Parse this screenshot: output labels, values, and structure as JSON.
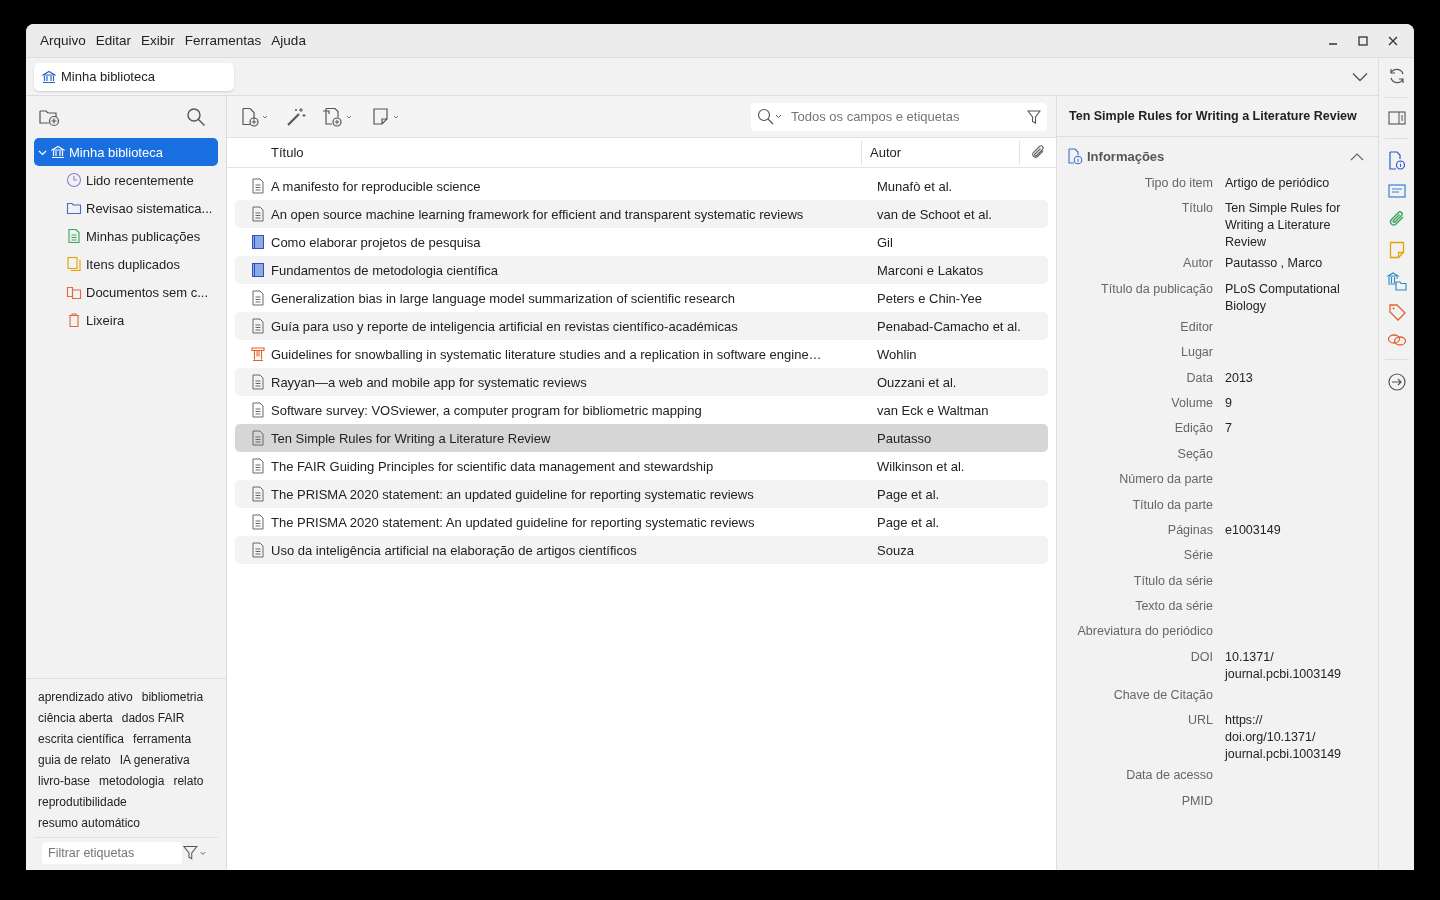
{
  "menu": [
    "Arquivo",
    "Editar",
    "Exibir",
    "Ferramentas",
    "Ajuda"
  ],
  "tab": {
    "label": "Minha biblioteca"
  },
  "collections": [
    {
      "label": "Minha biblioteca",
      "kind": "library",
      "selected": true,
      "expanded": true,
      "children": [
        {
          "label": "Lido recentemente",
          "kind": "recent",
          "selected": false
        },
        {
          "label": "Revisao sistematica...",
          "kind": "folder",
          "selected": false
        },
        {
          "label": "Minhas publicações",
          "kind": "publications",
          "selected": false
        },
        {
          "label": "Itens duplicados",
          "kind": "duplicates",
          "selected": false
        },
        {
          "label": "Documentos sem c...",
          "kind": "unfiled",
          "selected": false
        },
        {
          "label": "Lixeira",
          "kind": "trash",
          "selected": false
        }
      ]
    }
  ],
  "tags": [
    "aprendizado ativo",
    "bibliometria",
    "ciência aberta",
    "dados FAIR",
    "escrita científica",
    "ferramenta",
    "guia de relato",
    "IA generativa",
    "livro-base",
    "metodologia",
    "relato",
    "reprodutibilidade",
    "resumo automático"
  ],
  "tag_filter": {
    "placeholder": "Filtrar etiquetas"
  },
  "search": {
    "placeholder": "Todos os campos e etiquetas"
  },
  "table": {
    "columns": [
      "Título",
      "Autor"
    ],
    "rows": [
      {
        "kind": "article",
        "title": "A manifesto for reproducible science",
        "author": "Munafò et al.",
        "selected": false
      },
      {
        "kind": "article",
        "title": "An open source machine learning framework for efficient and transparent systematic reviews",
        "author": "van de Schoot et al.",
        "selected": false
      },
      {
        "kind": "book",
        "title": "Como elaborar projetos de pesquisa",
        "author": "Gil",
        "selected": false
      },
      {
        "kind": "book",
        "title": "Fundamentos de metodologia científica",
        "author": "Marconi e Lakatos",
        "selected": false
      },
      {
        "kind": "article",
        "title": "Generalization bias in large language model summarization of scientific research",
        "author": "Peters e Chin-Yee",
        "selected": false
      },
      {
        "kind": "article",
        "title": "Guía para uso y reporte de inteligencia artificial en revistas científico-académicas",
        "author": "Penabad-Camacho et al.",
        "selected": false
      },
      {
        "kind": "conference",
        "title": "Guidelines for snowballing in systematic literature studies and a replication in software engine…",
        "author": "Wohlin",
        "selected": false
      },
      {
        "kind": "article",
        "title": "Rayyan—a web and mobile app for systematic reviews",
        "author": "Ouzzani et al.",
        "selected": false
      },
      {
        "kind": "article",
        "title": "Software survey: VOSviewer, a computer program for bibliometric mapping",
        "author": "van Eck e Waltman",
        "selected": false
      },
      {
        "kind": "article",
        "title": "Ten Simple Rules for Writing a Literature Review",
        "author": "Pautasso",
        "selected": true
      },
      {
        "kind": "article",
        "title": "The FAIR Guiding Principles for scientific data management and stewardship",
        "author": "Wilkinson et al.",
        "selected": false
      },
      {
        "kind": "article",
        "title": "The PRISMA 2020 statement: an updated guideline for reporting systematic reviews",
        "author": "Page et al.",
        "selected": false
      },
      {
        "kind": "article",
        "title": "The PRISMA 2020 statement: An updated guideline for reporting systematic reviews",
        "author": "Page et al.",
        "selected": false
      },
      {
        "kind": "article",
        "title": "Uso da inteligência artificial na elaboração de artigos científicos",
        "author": "Souza",
        "selected": false
      }
    ]
  },
  "item_pane": {
    "title": "Ten Simple Rules for Writing a Literature Review",
    "section": {
      "label": "Informações",
      "expanded": true
    },
    "fields": [
      {
        "label": "Tipo do item",
        "value": "Artigo de periódico"
      },
      {
        "label": "Título",
        "value": "Ten Simple Rules for Writing a Literature Review"
      },
      {
        "label": "Autor",
        "value": "Pautasso , Marco"
      },
      {
        "label": "Título da publicação",
        "value": "PLoS Computational Biology"
      },
      {
        "label": "Editor"
      },
      {
        "label": "Lugar"
      },
      {
        "label": "Data",
        "value": "2013"
      },
      {
        "label": "Volume",
        "value": "9"
      },
      {
        "label": "Edição",
        "value": "7"
      },
      {
        "label": "Seção"
      },
      {
        "label": "Número da parte"
      },
      {
        "label": "Título da parte"
      },
      {
        "label": "Páginas",
        "value": "e1003149"
      },
      {
        "label": "Série"
      },
      {
        "label": "Título da série"
      },
      {
        "label": "Texto da série"
      },
      {
        "label": "Abreviatura do periódico"
      },
      {
        "label": "DOI",
        "value": "10.1371/ journal.pcbi.1003149"
      },
      {
        "label": "Chave de Citação"
      },
      {
        "label": "URL",
        "value": "https:// doi.org/10.1371/ journal.pcbi.1003149"
      },
      {
        "label": "Data de acesso"
      },
      {
        "label": "PMID"
      }
    ]
  }
}
